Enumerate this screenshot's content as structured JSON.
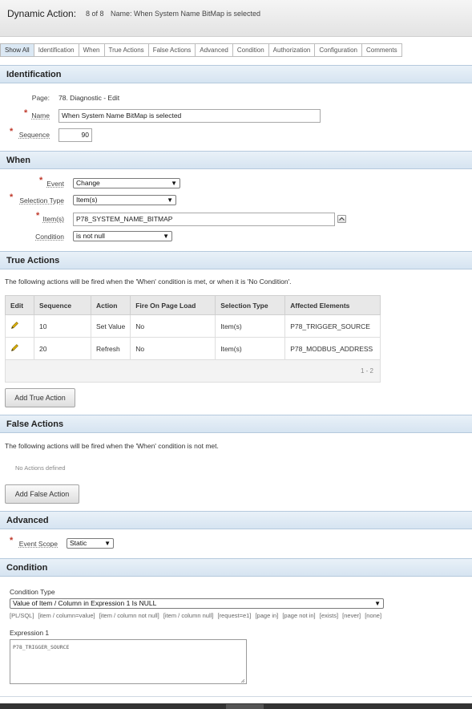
{
  "header": {
    "title": "Dynamic Action:",
    "count": "8 of 8",
    "name": "Name: When System Name BitMap is selected"
  },
  "tabs": [
    "Show All",
    "Identification",
    "When",
    "True Actions",
    "False Actions",
    "Advanced",
    "Condition",
    "Authorization",
    "Configuration",
    "Comments"
  ],
  "identification": {
    "section_title": "Identification",
    "page_label": "Page:",
    "page_value": "78. Diagnostic - Edit",
    "name_label": "Name",
    "name_value": "When System Name BitMap is selected",
    "sequence_label": "Sequence",
    "sequence_value": "90"
  },
  "when": {
    "section_title": "When",
    "event_label": "Event",
    "event_value": "Change",
    "selection_type_label": "Selection Type",
    "selection_type_value": "Item(s)",
    "items_label": "Item(s)",
    "items_value": "P78_SYSTEM_NAME_BITMAP",
    "condition_label": "Condition",
    "condition_value": "is not null"
  },
  "true_actions": {
    "section_title": "True Actions",
    "description": "The following actions will be fired when the 'When' condition is met, or when it is 'No Condition'.",
    "columns": [
      "Edit",
      "Sequence",
      "Action",
      "Fire On Page Load",
      "Selection Type",
      "Affected Elements"
    ],
    "rows": [
      {
        "sequence": "10",
        "action": "Set Value",
        "fire_on_load": "No",
        "selection_type": "Item(s)",
        "affected": "P78_TRIGGER_SOURCE"
      },
      {
        "sequence": "20",
        "action": "Refresh",
        "fire_on_load": "No",
        "selection_type": "Item(s)",
        "affected": "P78_MODBUS_ADDRESS"
      }
    ],
    "pagination": "1 - 2",
    "add_button": "Add True Action"
  },
  "false_actions": {
    "section_title": "False Actions",
    "description": "The following actions will be fired when the 'When' condition is not met.",
    "empty_text": "No Actions defined",
    "add_button": "Add False Action"
  },
  "advanced": {
    "section_title": "Advanced",
    "event_scope_label": "Event Scope",
    "event_scope_value": "Static"
  },
  "condition": {
    "section_title": "Condition",
    "type_label": "Condition Type",
    "type_value": "Value of Item / Column in Expression 1 Is NULL",
    "shortcuts": [
      "[PL/SQL]",
      "[item / column=value]",
      "[item / column not null]",
      "[item / column null]",
      "[request=e1]",
      "[page in]",
      "[page not in]",
      "[exists]",
      "[never]",
      "[none]"
    ],
    "expression_label": "Expression 1",
    "expression_value": "P78_TRIGGER_SOURCE"
  },
  "colors": {
    "section_bg": "#dbe8f4",
    "required": "#c0392b",
    "active_tab": "#dbe8f4"
  }
}
